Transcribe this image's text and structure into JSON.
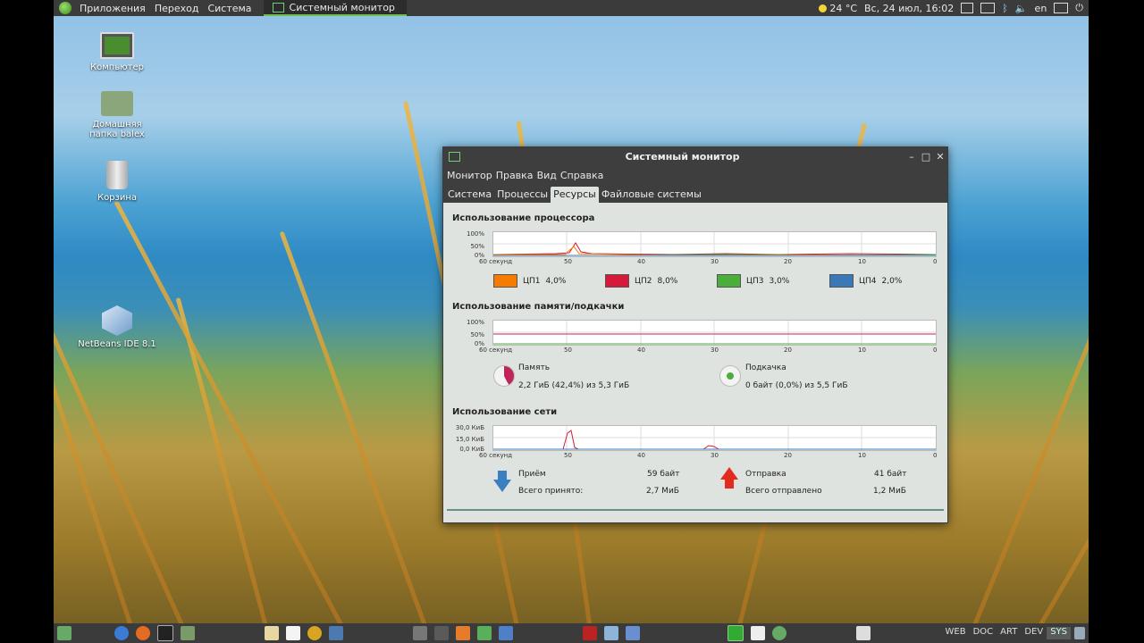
{
  "top_panel": {
    "menu": [
      "Приложения",
      "Переход",
      "Система"
    ],
    "task": "Системный монитор",
    "weather": "24 °C",
    "datetime": "Вс, 24 июл, 16:02",
    "lang": "en"
  },
  "desktop": {
    "icons": [
      {
        "label": "Компьютер"
      },
      {
        "label": "Домашняя папка balex"
      },
      {
        "label": "Корзина"
      },
      {
        "label": "NetBeans IDE 8.1"
      }
    ]
  },
  "window": {
    "title": "Системный монитор",
    "menu": [
      "Монитор",
      "Правка",
      "Вид",
      "Справка"
    ],
    "tabs": [
      "Система",
      "Процессы",
      "Ресурсы",
      "Файловые системы"
    ],
    "active_tab": "Ресурсы",
    "cpu": {
      "title": "Использование процессора",
      "yticks": [
        "100%",
        "50%",
        "0%"
      ],
      "xticks": [
        "60 секунд",
        "50",
        "40",
        "30",
        "20",
        "10",
        "0"
      ],
      "legend": [
        {
          "name": "ЦП1",
          "value": "4,0%",
          "color": "#f57c00"
        },
        {
          "name": "ЦП2",
          "value": "8,0%",
          "color": "#d51a3a"
        },
        {
          "name": "ЦП3",
          "value": "3,0%",
          "color": "#4cae3a"
        },
        {
          "name": "ЦП4",
          "value": "2,0%",
          "color": "#3a78b8"
        }
      ]
    },
    "memory": {
      "title": "Использование памяти/подкачки",
      "yticks": [
        "100%",
        "50%",
        "0%"
      ],
      "xticks": [
        "60 секунд",
        "50",
        "40",
        "30",
        "20",
        "10",
        "0"
      ],
      "mem_label": "Память",
      "mem_value": "2,2 ГиБ (42,4%) из 5,3 ГиБ",
      "mem_fraction": 0.424,
      "swap_label": "Подкачка",
      "swap_value": "0 байт (0,0%) из 5,5 ГиБ",
      "mem_color": "#c0255a",
      "swap_color": "#4cae3a"
    },
    "network": {
      "title": "Использование сети",
      "yticks": [
        "30,0 КиБ",
        "15,0 КиБ",
        "0,0 КиБ"
      ],
      "xticks": [
        "60 секунд",
        "50",
        "40",
        "30",
        "20",
        "10",
        "0"
      ],
      "recv_label": "Приём",
      "recv_value": "59 байт",
      "recv_total_label": "Всего принято:",
      "recv_total": "2,7 МиБ",
      "send_label": "Отправка",
      "send_value": "41 байт",
      "send_total_label": "Всего отправлено",
      "send_total": "1,2 МиБ"
    }
  },
  "bottom_panel": {
    "workspaces": [
      "WEB",
      "DOC",
      "ART",
      "DEV",
      "SYS"
    ],
    "active_workspace": "SYS"
  }
}
